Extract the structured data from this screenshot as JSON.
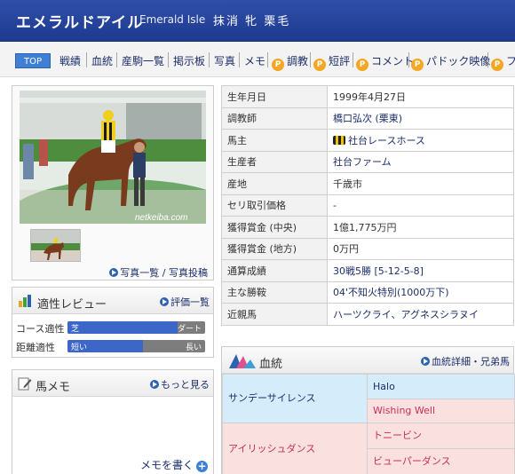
{
  "header": {
    "name_jp": "エメラルドアイル",
    "name_en": "Emerald Isle",
    "status": "抹消 牝 栗毛"
  },
  "nav": {
    "top": "TOP",
    "items": [
      "戦績",
      "血統",
      "産駒一覧",
      "掲示板",
      "写真",
      "メモ",
      "調教",
      "短評",
      "コメント",
      "パドック映像",
      "フォ"
    ]
  },
  "photo": {
    "watermark": "netkeiba.com",
    "links": "写真一覧 / 写真投稿"
  },
  "review": {
    "title": "適性レビュー",
    "link": "評価一覧",
    "rows": [
      {
        "label": "コース適性",
        "left": "芝",
        "right": "ダート",
        "level": 0.8
      },
      {
        "label": "距離適性",
        "left": "短い",
        "right": "長い",
        "level": 0.55
      }
    ]
  },
  "memo": {
    "title": "馬メモ",
    "link": "もっと見る",
    "write": "メモを書く"
  },
  "profile": [
    {
      "k": "生年月日",
      "v": "1999年4月27日",
      "link": false
    },
    {
      "k": "調教師",
      "v": "橋口弘次 (栗東)",
      "link": true
    },
    {
      "k": "馬主",
      "v": "社台レースホース",
      "link": true,
      "silks": true
    },
    {
      "k": "生産者",
      "v": "社台ファーム",
      "link": true
    },
    {
      "k": "産地",
      "v": "千歳市",
      "link": false
    },
    {
      "k": "セリ取引価格",
      "v": "-",
      "link": false
    },
    {
      "k": "獲得賞金 (中央)",
      "v": "1億1,775万円",
      "link": false
    },
    {
      "k": "獲得賞金 (地方)",
      "v": "0万円",
      "link": false
    },
    {
      "k": "通算成績",
      "v": "30戦5勝 [5-12-5-8]",
      "link": true
    },
    {
      "k": "主な勝鞍",
      "v": "04'不知火特別(1000万下)",
      "link": true
    },
    {
      "k": "近親馬",
      "v": "ハーツクライ、アグネスシラヌイ",
      "link": true
    }
  ],
  "pedigree": {
    "title": "血統",
    "link": "血統詳細・兄弟馬",
    "sire": "サンデーサイレンス",
    "sire_sire": "Halo",
    "sire_dam": "Wishing Well",
    "dam": "アイリッシュダンス",
    "dam_sire": "トニービン",
    "dam_dam": "ビューパーダンス"
  },
  "colors": {
    "header": "#2a48a0",
    "accent": "#3c66c7",
    "sire_bg": "#d5ecfb",
    "dam_bg": "#fbe0e0"
  }
}
